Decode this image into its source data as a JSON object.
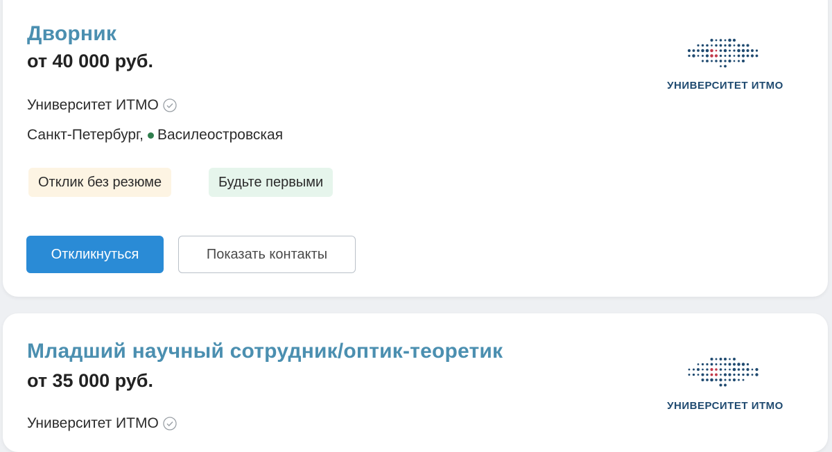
{
  "vacancies": [
    {
      "title": "Дворник",
      "salary": "от 40 000 руб.",
      "company": "Университет ИТМО",
      "city": "Санкт-Петербург,",
      "metro": "Василеостровская",
      "tags": [
        "Отклик без резюме",
        "Будьте первыми"
      ],
      "respond_label": "Откликнуться",
      "contacts_label": "Показать контакты",
      "logo_text": "УНИВЕРСИТЕТ ИТМО"
    },
    {
      "title": "Младший научный сотрудник/оптик-теоретик",
      "salary": "от 35 000 руб.",
      "company": "Университет ИТМО",
      "logo_text": "УНИВЕРСИТЕТ ИТМО"
    }
  ],
  "colors": {
    "title": "#4b8fb0",
    "primary_button": "#2a8bd6",
    "metro_line": "#2f7d4d",
    "logo_dots": "#1f4a70",
    "logo_accent": "#c23a4b"
  },
  "icons": {
    "verified": "check-circle-icon",
    "metro": "metro-dot-icon"
  }
}
